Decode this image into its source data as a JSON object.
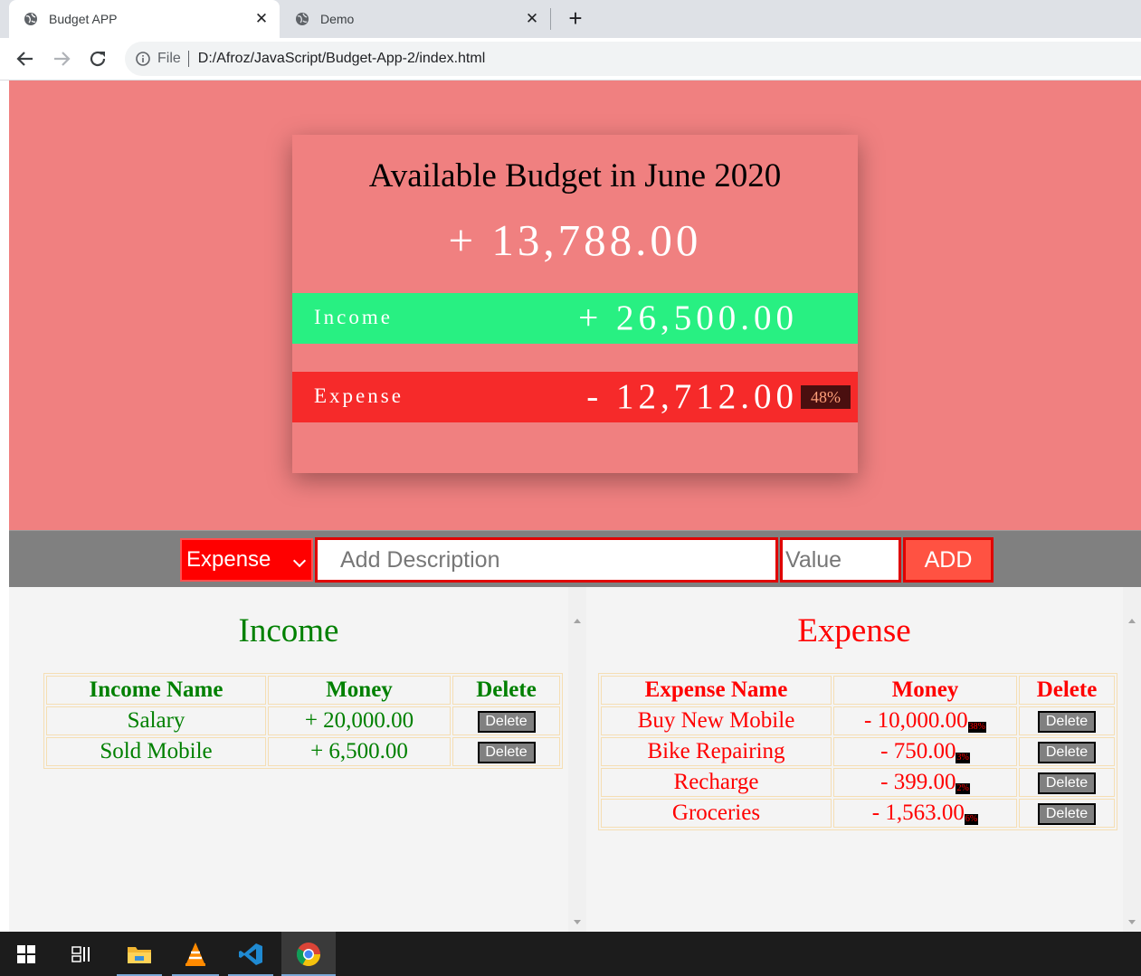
{
  "browser": {
    "tabs": [
      {
        "title": "Budget APP",
        "active": true
      },
      {
        "title": "Demo",
        "active": false
      }
    ],
    "address": {
      "scheme": "File",
      "url": "D:/Afroz/JavaScript/Budget-App-2/index.html"
    }
  },
  "budget": {
    "heading": "Available Budget in June 2020",
    "available": "+ 13,788.00",
    "income_label": "Income",
    "income_value": "+ 26,500.00",
    "expense_label": "Expense",
    "expense_value": "- 12,712.00",
    "expense_percent": "48%"
  },
  "form": {
    "type_selected": "Expense",
    "description_placeholder": "Add Description",
    "value_placeholder": "Value",
    "add_label": "ADD"
  },
  "income": {
    "title": "Income",
    "headers": [
      "Income Name",
      "Money",
      "Delete"
    ],
    "rows": [
      {
        "name": "Salary",
        "money": "+ 20,000.00",
        "delete": "Delete"
      },
      {
        "name": "Sold Mobile",
        "money": "+ 6,500.00",
        "delete": "Delete"
      }
    ]
  },
  "expense": {
    "title": "Expense",
    "headers": [
      "Expense Name",
      "Money",
      "Delete"
    ],
    "rows": [
      {
        "name": "Buy New Mobile",
        "money": "- 10,000.00",
        "percent": "38%",
        "delete": "Delete"
      },
      {
        "name": "Bike Repairing",
        "money": "- 750.00",
        "percent": "3%",
        "delete": "Delete"
      },
      {
        "name": "Recharge",
        "money": "- 399.00",
        "percent": "2%",
        "delete": "Delete"
      },
      {
        "name": "Groceries",
        "money": "- 1,563.00",
        "percent": "6%",
        "delete": "Delete"
      }
    ]
  },
  "colors": {
    "page_bg": "#f08080",
    "income_strip": "#28f082",
    "expense_strip": "#f62a2a",
    "income_text": "#008000",
    "expense_text": "#ff0000"
  },
  "taskbar": {
    "icons": [
      "windows-start-icon",
      "task-view-icon",
      "file-explorer-icon",
      "vlc-icon",
      "vscode-icon",
      "chrome-icon"
    ]
  }
}
